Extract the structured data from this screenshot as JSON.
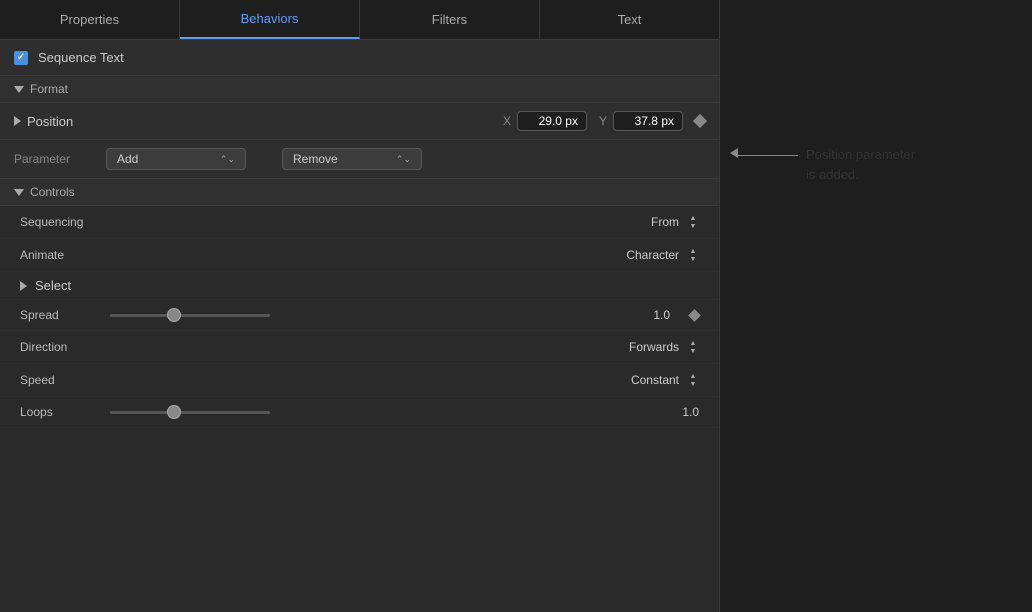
{
  "tabs": [
    {
      "id": "properties",
      "label": "Properties",
      "active": false
    },
    {
      "id": "behaviors",
      "label": "Behaviors",
      "active": true
    },
    {
      "id": "filters",
      "label": "Filters",
      "active": false
    },
    {
      "id": "text",
      "label": "Text",
      "active": false
    }
  ],
  "sequence_text": {
    "label": "Sequence Text",
    "checked": true
  },
  "format": {
    "label": "Format"
  },
  "position": {
    "label": "Position",
    "x_label": "X",
    "x_value": "29.0 px",
    "y_label": "Y",
    "y_value": "37.8 px"
  },
  "parameter": {
    "label": "Parameter",
    "add_label": "Add",
    "remove_label": "Remove"
  },
  "controls": {
    "label": "Controls"
  },
  "sequencing": {
    "label": "Sequencing",
    "value": "From"
  },
  "animate": {
    "label": "Animate",
    "value": "Character"
  },
  "select": {
    "label": "Select"
  },
  "spread": {
    "label": "Spread",
    "value": "1.0"
  },
  "direction": {
    "label": "Direction",
    "value": "Forwards"
  },
  "speed": {
    "label": "Speed",
    "value": "Constant"
  },
  "loops": {
    "label": "Loops",
    "value": "1.0"
  },
  "annotation": {
    "line1": "Position parameter",
    "line2": "is added."
  }
}
